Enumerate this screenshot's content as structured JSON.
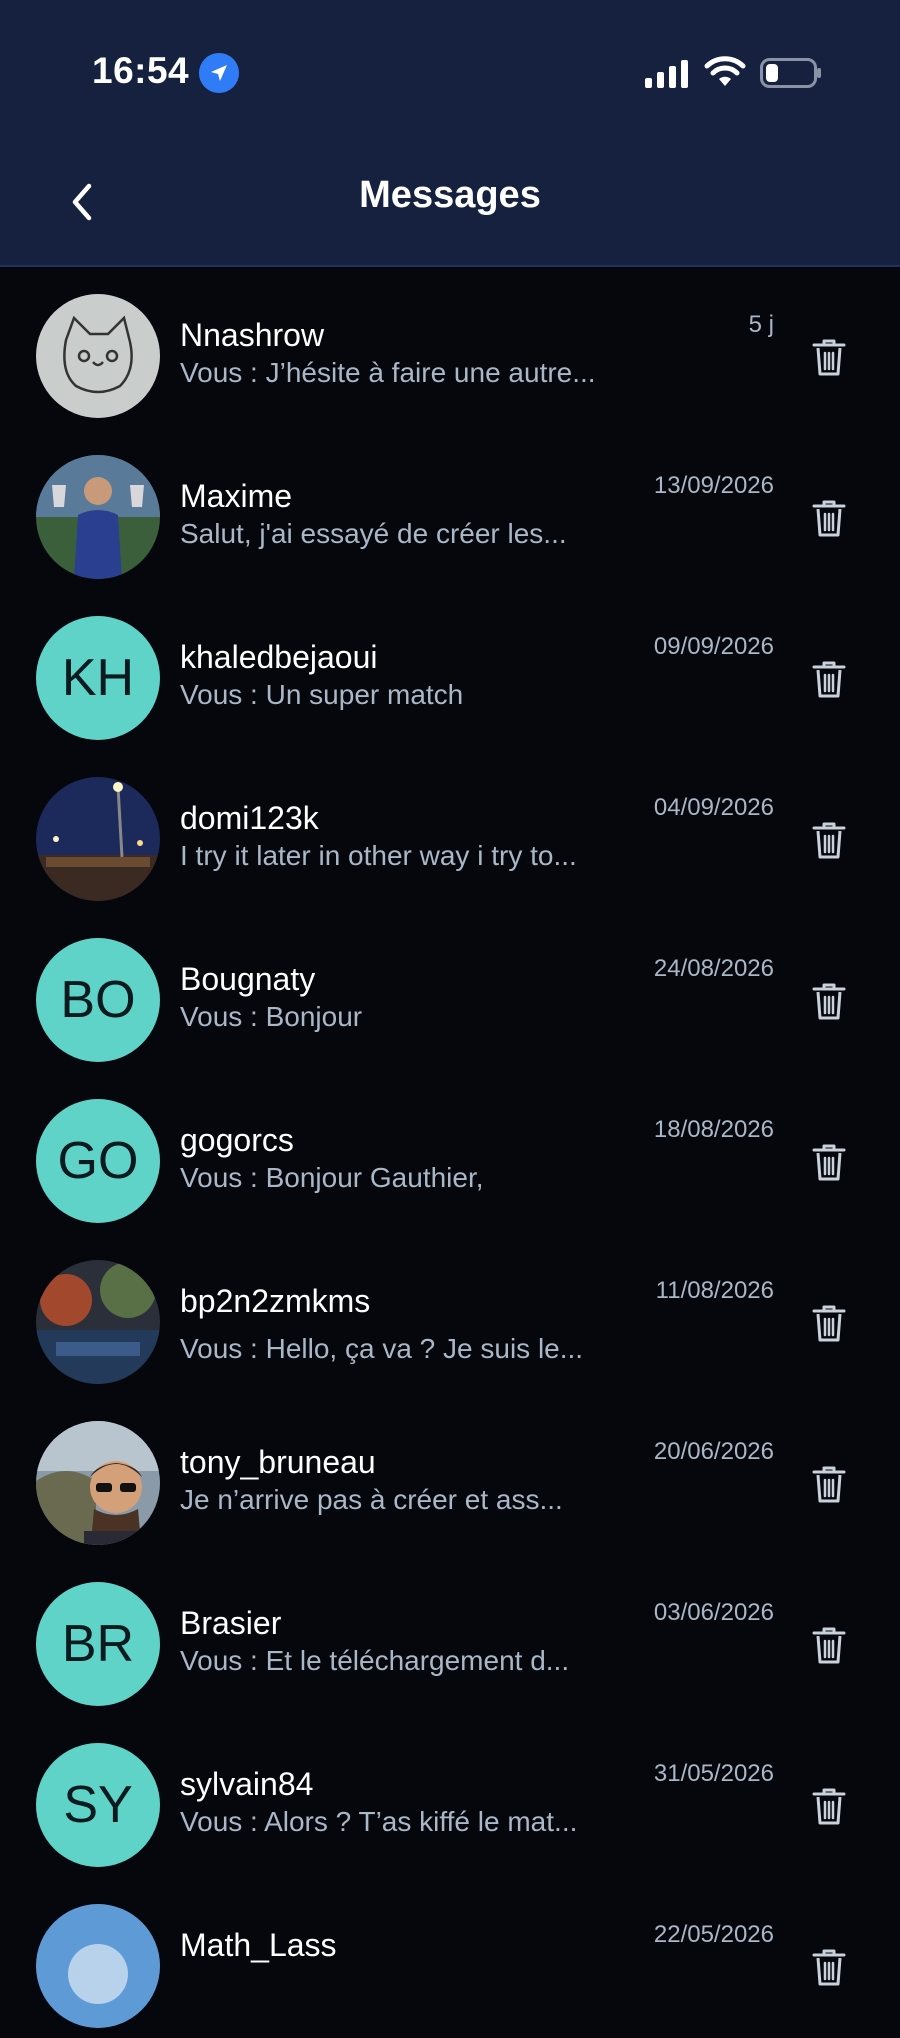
{
  "status_bar": {
    "time": "16:54"
  },
  "header": {
    "title": "Messages"
  },
  "colors": {
    "header_bg": "#15213f",
    "page_bg": "#05070d",
    "avatar_initials_bg": "#5fd3c8",
    "secondary_text": "#a9b7c6",
    "location_badge": "#2f7cf6"
  },
  "conversations": [
    {
      "name": "Nnashrow",
      "preview": "Vous : J’hésite à faire une autre...",
      "date": "5 j",
      "avatar": {
        "type": "image",
        "icon": "cat-drawing-avatar"
      }
    },
    {
      "name": "Maxime",
      "preview": "Salut, j'ai essayé de créer les...",
      "date": "13/09/2026",
      "avatar": {
        "type": "image",
        "icon": "person-trophies-avatar"
      }
    },
    {
      "name": "khaledbejaoui",
      "preview": "Vous : Un super match",
      "date": "09/09/2026",
      "avatar": {
        "type": "initials",
        "initials": "KH"
      }
    },
    {
      "name": "domi123k",
      "preview": "I try it later in other way i try to...",
      "date": "04/09/2026",
      "avatar": {
        "type": "image",
        "icon": "stadium-night-avatar"
      }
    },
    {
      "name": "Bougnaty",
      "preview": "Vous : Bonjour",
      "date": "24/08/2026",
      "avatar": {
        "type": "initials",
        "initials": "BO"
      }
    },
    {
      "name": "gogorcs",
      "preview": "Vous : Bonjour Gauthier,",
      "date": "18/08/2026",
      "avatar": {
        "type": "initials",
        "initials": "GO"
      }
    },
    {
      "name": "bp2n2zmkms",
      "preview": "Vous : Hello, ça va ? Je suis le...",
      "date": "11/08/2026",
      "avatar": {
        "type": "image",
        "icon": "fans-flares-avatar"
      }
    },
    {
      "name": "tony_bruneau",
      "preview": "Je n’arrive pas à créer et ass...",
      "date": "20/06/2026",
      "avatar": {
        "type": "image",
        "icon": "man-sunglasses-avatar"
      }
    },
    {
      "name": "Brasier",
      "preview": "Vous : Et le téléchargement d...",
      "date": "03/06/2026",
      "avatar": {
        "type": "initials",
        "initials": "BR"
      }
    },
    {
      "name": "sylvain84",
      "preview": "Vous : Alors ? T’as kiffé le mat...",
      "date": "31/05/2026",
      "avatar": {
        "type": "initials",
        "initials": "SY"
      }
    },
    {
      "name": "Math_Lass",
      "preview": "",
      "date": "22/05/2026",
      "avatar": {
        "type": "image",
        "icon": "sky-avatar"
      }
    }
  ]
}
